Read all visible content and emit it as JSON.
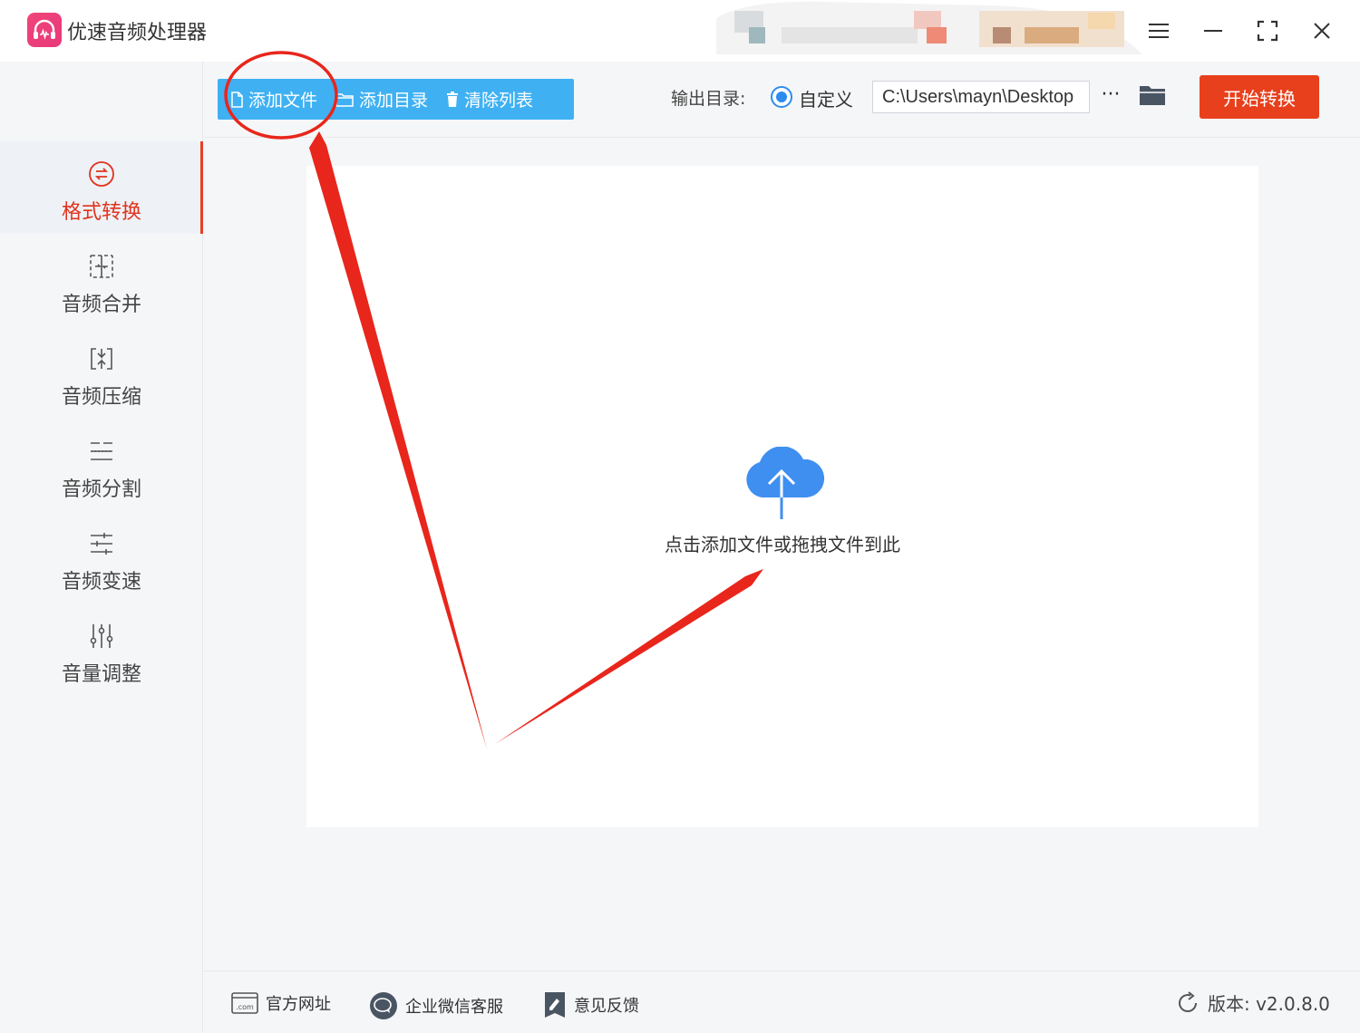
{
  "app": {
    "title": "优速音频处理器"
  },
  "sidebar": {
    "items": [
      {
        "label": "格式转换",
        "icon": "format-convert-icon",
        "active": true
      },
      {
        "label": "音频合并",
        "icon": "merge-icon",
        "active": false
      },
      {
        "label": "音频压缩",
        "icon": "compress-icon",
        "active": false
      },
      {
        "label": "音频分割",
        "icon": "split-icon",
        "active": false
      },
      {
        "label": "音频变速",
        "icon": "speed-icon",
        "active": false
      },
      {
        "label": "音量调整",
        "icon": "volume-icon",
        "active": false
      }
    ]
  },
  "toolbar": {
    "add_file": "添加文件",
    "add_folder": "添加目录",
    "clear_list": "清除列表",
    "output_label": "输出目录:",
    "custom_label": "自定义",
    "output_path": "C:\\Users\\mayn\\Desktop",
    "more": "···",
    "start": "开始转换"
  },
  "dropzone": {
    "text": "点击添加文件或拖拽文件到此"
  },
  "footer": {
    "website": "官方网址",
    "wechat": "企业微信客服",
    "feedback": "意见反馈",
    "version": "版本: v2.0.8.0"
  },
  "colors": {
    "accent_blue": "#3fb1f3",
    "start_button": "#e8401c",
    "active_nav": "#e0341d",
    "annotation_red": "#e8261c"
  }
}
